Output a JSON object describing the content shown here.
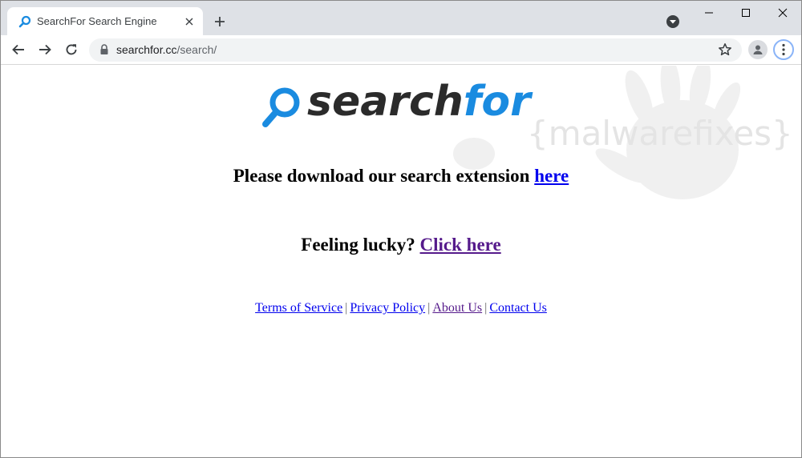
{
  "browser": {
    "tab_title": "SearchFor Search Engine",
    "url_host": "searchfor.cc",
    "url_path": "/search/"
  },
  "icons": {
    "favicon": "magnifier-favicon-icon",
    "close": "close-icon",
    "new_tab": "plus-icon",
    "tab_search": "chevron-down-circle-icon",
    "minimize": "minimize-icon",
    "maximize": "maximize-icon",
    "window_close": "close-icon",
    "back": "back-arrow-icon",
    "forward": "forward-arrow-icon",
    "reload": "reload-icon",
    "lock": "lock-icon",
    "bookmark": "star-icon",
    "profile": "person-icon",
    "menu": "kebab-menu-icon"
  },
  "logo": {
    "part1": "search",
    "part2": "for",
    "dark_color": "#2b2b2b",
    "brand_color": "#1a8be0"
  },
  "watermark": {
    "text": "{malwarefixes}"
  },
  "content": {
    "download_text": "Please download our search extension",
    "download_link": "here",
    "lucky_text": "Feeling lucky?",
    "lucky_link": "Click here"
  },
  "footer": {
    "links": [
      "Terms of Service",
      "Privacy Policy",
      "About Us",
      "Contact Us"
    ],
    "separator": "|"
  },
  "colors": {
    "link_unvisited": "#0000ee",
    "link_visited": "#551a8b",
    "tabstrip_bg": "#dee1e6"
  }
}
